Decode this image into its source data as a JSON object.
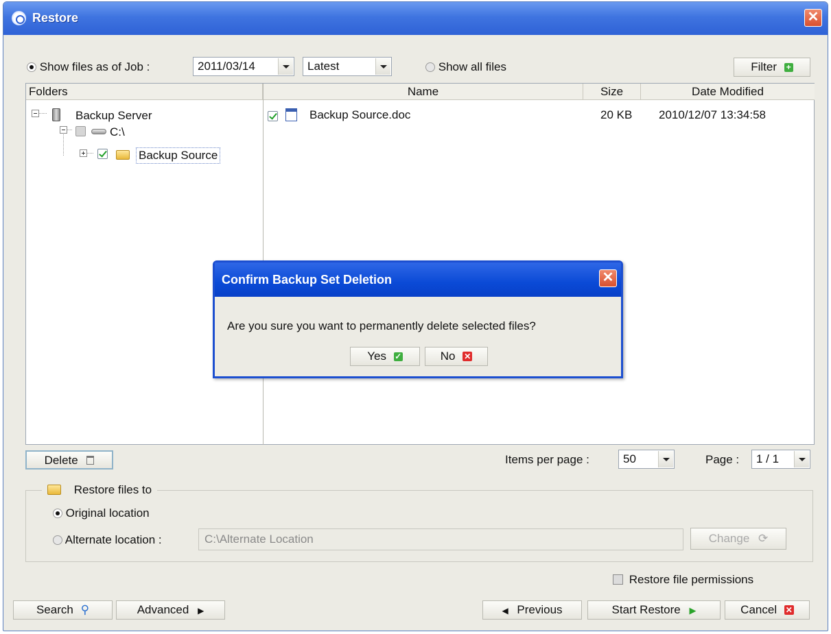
{
  "window": {
    "title": "Restore",
    "close_glyph": "✕"
  },
  "toolbar": {
    "show_files_as_of_job_label": "Show files as of Job :",
    "job_date": "2011/03/14",
    "job_version": "Latest",
    "show_all_files_label": "Show all files",
    "filter_label": "Filter",
    "filter_icon": "plus-icon"
  },
  "folders": {
    "header": "Folders",
    "tree": [
      {
        "label": "Backup Server",
        "icon": "server-icon"
      },
      {
        "label": "C:\\",
        "icon": "drive-icon"
      },
      {
        "label": "Backup Source",
        "icon": "folder-icon"
      }
    ]
  },
  "files": {
    "columns": [
      "Name",
      "Size",
      "Date Modified"
    ],
    "rows": [
      {
        "name": "Backup Source.doc",
        "size": "20 KB",
        "date": "2010/12/07 13:34:58",
        "icon": "word-doc-icon"
      }
    ]
  },
  "pager": {
    "delete_label": "Delete",
    "items_per_page_label": "Items per page :",
    "items_per_page": "50",
    "page_label": "Page :",
    "page_value": "1 / 1"
  },
  "restore_to": {
    "legend": "Restore files to",
    "original_label": "Original location",
    "alternate_label": "Alternate location :",
    "alternate_value": "C:\\Alternate Location",
    "change_label": "Change",
    "permissions_label": "Restore file permissions"
  },
  "footer": {
    "search_label": "Search",
    "advanced_label": "Advanced",
    "previous_label": "Previous",
    "start_restore_label": "Start Restore",
    "cancel_label": "Cancel"
  },
  "dialog": {
    "title": "Confirm Backup Set Deletion",
    "message": "Are you sure you want to permanently delete selected files?",
    "yes_label": "Yes",
    "no_label": "No"
  },
  "colors": {
    "titlebar": "#3f74e0",
    "dialog_border": "#1c4fd0",
    "accent_green": "#3fae3f",
    "accent_red": "#e02c2c"
  }
}
